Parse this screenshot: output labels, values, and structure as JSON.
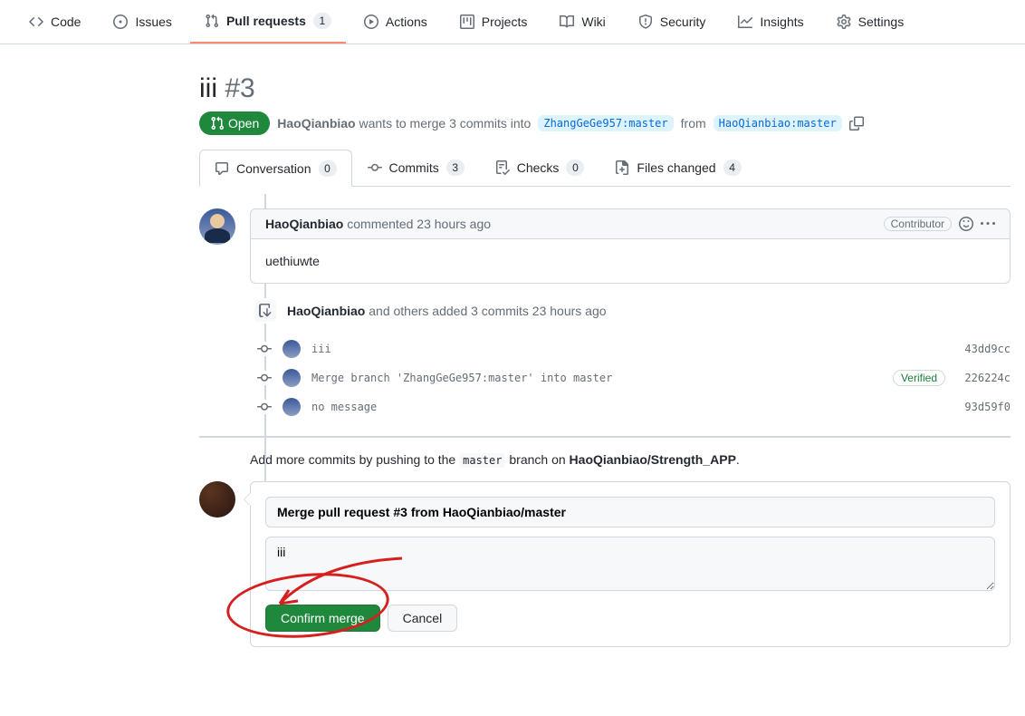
{
  "nav": {
    "code": "Code",
    "issues": "Issues",
    "pulls": "Pull requests",
    "pulls_count": "1",
    "actions": "Actions",
    "projects": "Projects",
    "wiki": "Wiki",
    "security": "Security",
    "insights": "Insights",
    "settings": "Settings"
  },
  "pr": {
    "title": "iii",
    "number": "#3",
    "state": "Open",
    "author": "HaoQianbiao",
    "merge_text": "wants to merge 3 commits into",
    "base_branch": "ZhangGeGe957:master",
    "from_text": "from",
    "head_branch": "HaoQianbiao:master"
  },
  "subnav": {
    "conversation": "Conversation",
    "conversation_count": "0",
    "commits": "Commits",
    "commits_count": "3",
    "checks": "Checks",
    "checks_count": "0",
    "files": "Files changed",
    "files_count": "4"
  },
  "comment": {
    "author": "HaoQianbiao",
    "action": "commented",
    "time": "23 hours ago",
    "role": "Contributor",
    "body": "uethiuwte"
  },
  "commits_event": {
    "author": "HaoQianbiao",
    "and_others": "and others added 3 commits",
    "time": "23 hours ago",
    "rows": [
      {
        "msg": "iii",
        "verified": false,
        "sha": "43dd9cc"
      },
      {
        "msg": "Merge branch 'ZhangGeGe957:master' into master",
        "verified": true,
        "sha": "226224c"
      },
      {
        "msg": "no message",
        "verified": false,
        "sha": "93d59f0"
      }
    ],
    "verified_label": "Verified"
  },
  "hint": {
    "pre": "Add more commits by pushing to the",
    "branch": "master",
    "mid": "branch on",
    "repo": "HaoQianbiao/Strength_APP",
    "post": "."
  },
  "merge": {
    "title_value": "Merge pull request #3 from HaoQianbiao/master",
    "body_value": "iii",
    "confirm": "Confirm merge",
    "cancel": "Cancel"
  }
}
